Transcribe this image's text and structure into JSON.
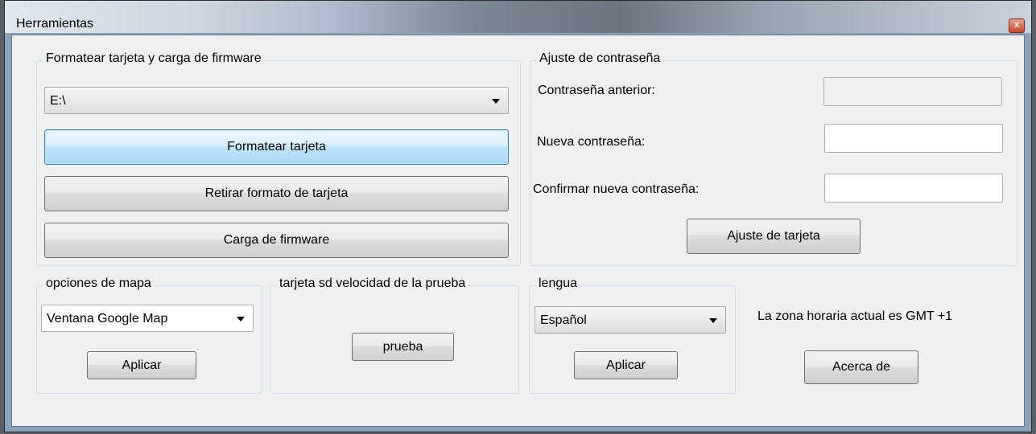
{
  "window": {
    "title": "Herramientas",
    "close_glyph": "x"
  },
  "format_group": {
    "legend": "Formatear tarjeta y carga de firmware",
    "drive_value": "E:\\",
    "format_button": "Formatear tarjeta",
    "unformat_button": "Retirar formato de tarjeta",
    "firmware_button": "Carga de firmware"
  },
  "password_group": {
    "legend": "Ajuste de contraseña",
    "old_label": "Contraseña anterior:",
    "new_label": "Nueva contraseña:",
    "confirm_label": "Confirmar nueva contraseña:",
    "old_value": "",
    "new_value": "",
    "confirm_value": "",
    "apply_button": "Ajuste de tarjeta"
  },
  "map_group": {
    "legend": "opciones de mapa",
    "selected": "Ventana Google Map",
    "apply_button": "Aplicar"
  },
  "sd_test_group": {
    "legend": "tarjeta sd velocidad de la prueba",
    "test_button": "prueba"
  },
  "language_group": {
    "legend": "lengua",
    "selected": "Español",
    "apply_button": "Aplicar"
  },
  "timezone": {
    "text": "La zona horaria actual es GMT +1",
    "about_button": "Acerca de"
  },
  "icons": {
    "dropdown": "chevron-down-icon",
    "close": "close-icon"
  }
}
